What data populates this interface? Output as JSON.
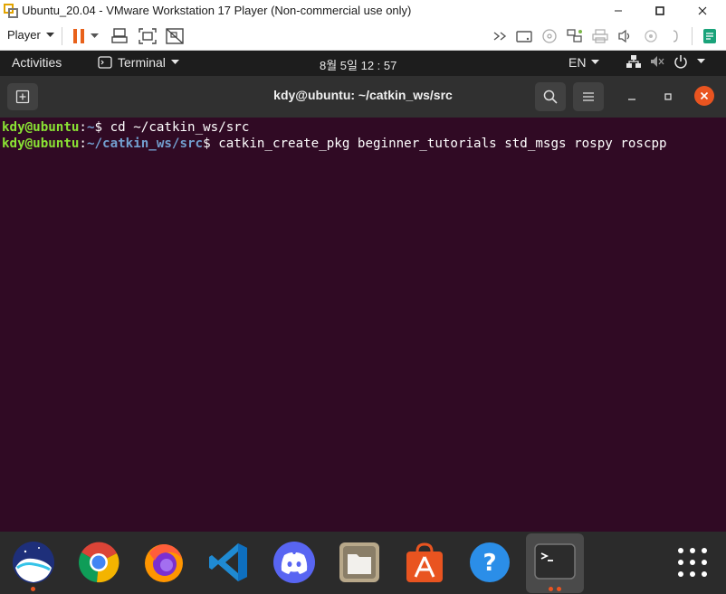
{
  "vmware": {
    "title": "Ubuntu_20.04 - VMware Workstation 17 Player (Non-commercial use only)",
    "player_menu": "Player"
  },
  "gnome_bar": {
    "activities": "Activities",
    "app_menu": "Terminal",
    "clock": "8월 5일  12 : 57",
    "language": "EN"
  },
  "terminal": {
    "title": "kdy@ubuntu: ~/catkin_ws/src",
    "lines": [
      {
        "user": "kdy@ubuntu",
        "sep": ":",
        "path": "~",
        "prompt": "$ ",
        "command": "cd ~/catkin_ws/src"
      },
      {
        "user": "kdy@ubuntu",
        "sep": ":",
        "path": "~/catkin_ws/src",
        "prompt": "$ ",
        "command": "catkin_create_pkg beginner_tutorials std_msgs rospy roscpp"
      }
    ]
  },
  "dock": {
    "items": [
      "naver-whale",
      "google-chrome",
      "firefox",
      "visual-studio-code",
      "discord",
      "files",
      "ubuntu-software",
      "help",
      "terminal",
      "show-applications"
    ]
  },
  "colors": {
    "terminal_bg": "#300a24",
    "prompt_user": "#8ae234",
    "prompt_path": "#729fcf",
    "ubuntu_orange": "#e95420",
    "vmware_pause": "#e8611a"
  }
}
